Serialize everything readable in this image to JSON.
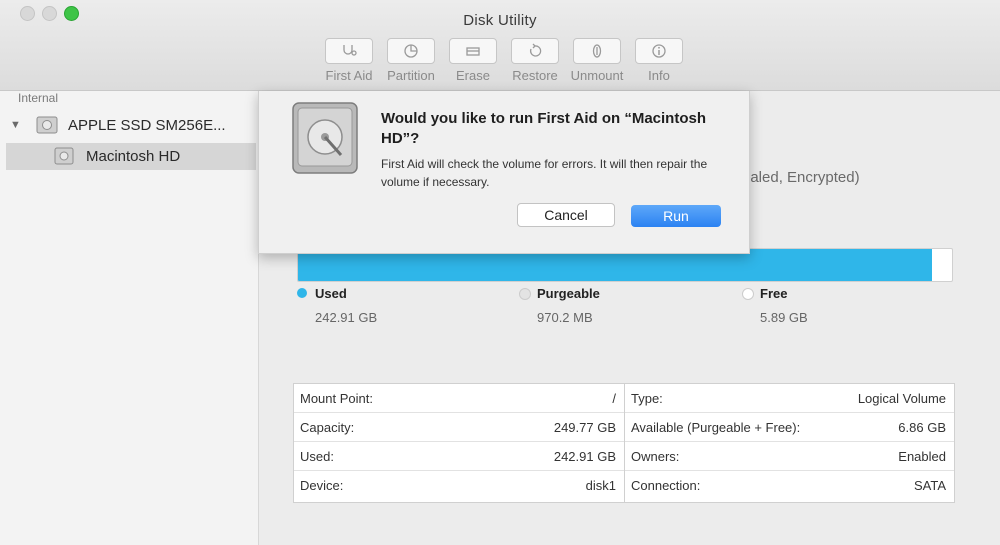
{
  "window": {
    "title": "Disk Utility"
  },
  "toolbar": [
    {
      "label": "First Aid",
      "icon": "stethoscope-icon"
    },
    {
      "label": "Partition",
      "icon": "pie-icon"
    },
    {
      "label": "Erase",
      "icon": "erase-icon"
    },
    {
      "label": "Restore",
      "icon": "restore-icon"
    },
    {
      "label": "Unmount",
      "icon": "eject-icon"
    },
    {
      "label": "Info",
      "icon": "info-icon"
    }
  ],
  "sidebar": {
    "section": "Internal",
    "disk": "APPLE SSD SM256E...",
    "volume": "Macintosh HD"
  },
  "main": {
    "volume_meta": "rnaled, Encrypted)",
    "usage": {
      "used_fraction": 0.97,
      "legend": [
        {
          "name": "Used",
          "value": "242.91 GB",
          "color": "#2fb6e9"
        },
        {
          "name": "Purgeable",
          "value": "970.2 MB",
          "color": "#e3e3e3"
        },
        {
          "name": "Free",
          "value": "5.89 GB",
          "color": "#ffffff"
        }
      ]
    },
    "info_left": [
      {
        "key": "Mount Point:",
        "value": "/"
      },
      {
        "key": "Capacity:",
        "value": "249.77 GB"
      },
      {
        "key": "Used:",
        "value": "242.91 GB"
      },
      {
        "key": "Device:",
        "value": "disk1"
      }
    ],
    "info_right": [
      {
        "key": "Type:",
        "value": "Logical Volume"
      },
      {
        "key": "Available (Purgeable + Free):",
        "value": "6.86 GB"
      },
      {
        "key": "Owners:",
        "value": "Enabled"
      },
      {
        "key": "Connection:",
        "value": "SATA"
      }
    ]
  },
  "dialog": {
    "question": "Would you like to run First Aid on “Macintosh HD”?",
    "description": "First Aid will check the volume for errors. It will then repair the volume if necessary.",
    "cancel_label": "Cancel",
    "run_label": "Run",
    "accent": "#2b82f2"
  }
}
